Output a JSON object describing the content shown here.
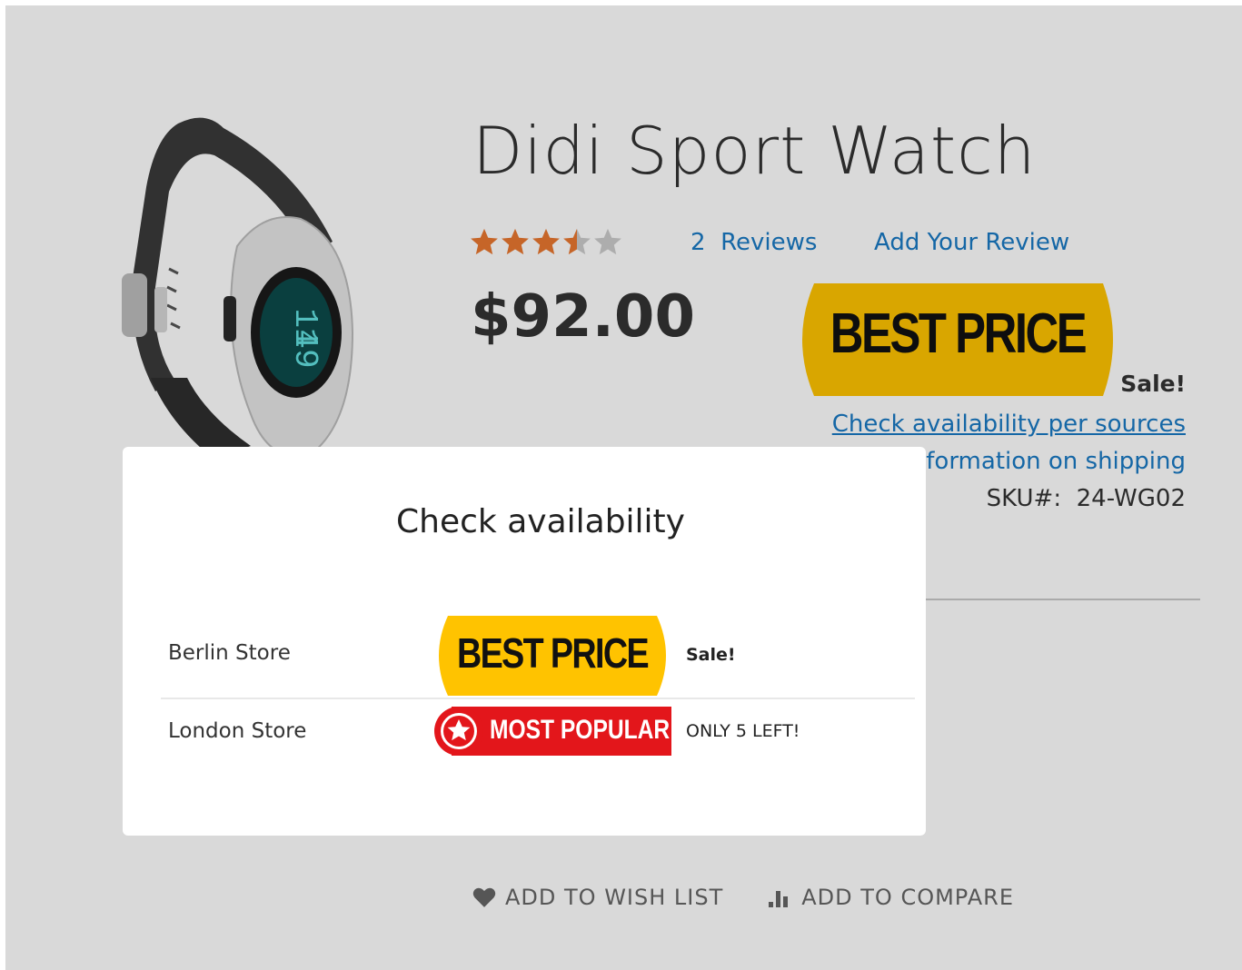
{
  "product": {
    "title": "Didi Sport Watch",
    "rating_stars": 3.5,
    "reviews_count": "2",
    "reviews_label": "Reviews",
    "add_review": "Add Your Review",
    "price": "$92.00",
    "badge_text": "BEST PRICE",
    "sale_label": "Sale!",
    "check_availability_link": "Check availability per sources",
    "shipping_link": "formation on shipping",
    "sku_label": "SKU#:",
    "sku_value": "24-WG02",
    "watch_display": [
      "11",
      "49"
    ],
    "colors": {
      "badge_yellow": "#ffc300",
      "badge_red": "#e3161b",
      "link": "#1979c3",
      "star_filled": "#e9772f",
      "star_empty": "#cccccc"
    }
  },
  "actions": {
    "wishlist": "ADD TO WISH LIST",
    "compare": "ADD TO COMPARE"
  },
  "modal": {
    "title": "Check availability",
    "stores": [
      {
        "name": "Berlin Store",
        "badge": "BEST PRICE",
        "label": "Sale!"
      },
      {
        "name": "London Store",
        "badge": "MOST POPULAR",
        "label": "ONLY 5 LEFT!"
      }
    ]
  }
}
